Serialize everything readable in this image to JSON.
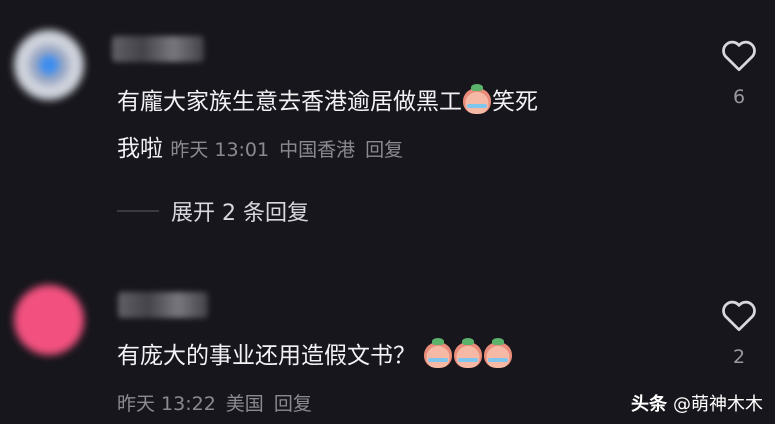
{
  "comments": [
    {
      "text_line1": "有龐大家族生意去香港逾居做黑工",
      "text_line1_tail": "笑死",
      "text_line2": "我啦",
      "time": "昨天 13:01",
      "location": "中国香港",
      "reply": "回复",
      "likes": "6"
    },
    {
      "text": "有庞大的事业还用造假文书？",
      "time": "昨天 13:22",
      "location": "美国",
      "reply": "回复",
      "likes": "2"
    }
  ],
  "expand_replies": "展开 2 条回复",
  "watermark": {
    "brand": "头条",
    "handle": "@萌神木木"
  },
  "colors": {
    "background": "#17161c",
    "meta": "#8b8a92",
    "avatar2": "#f2517f"
  },
  "icons": {
    "like": "heart-outline-icon",
    "emoji": "crying-laughing-emoji-icon"
  }
}
